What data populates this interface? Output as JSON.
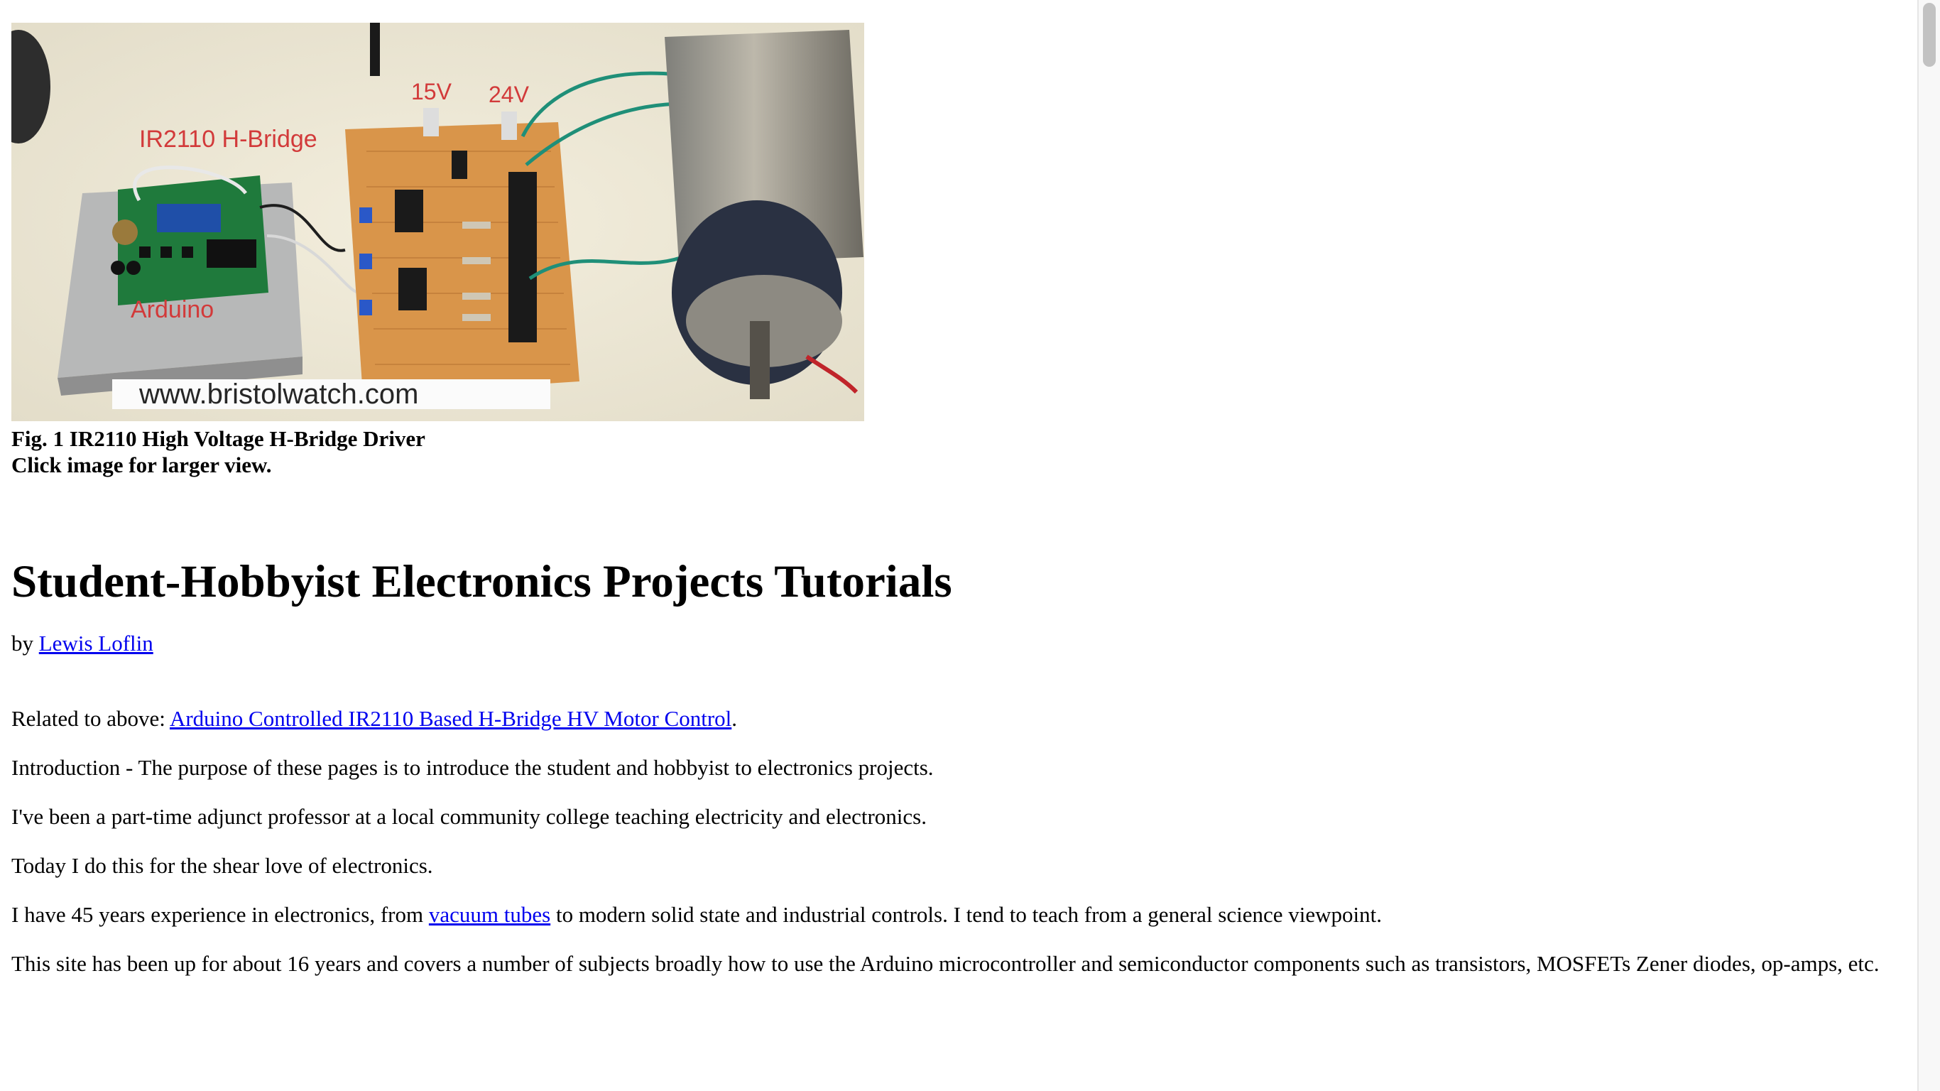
{
  "figure": {
    "labels": {
      "hbridge": "IR2110 H-Bridge",
      "arduino": "Arduino",
      "v15": "15V",
      "v24": "24V",
      "watermark": "www.bristolwatch.com"
    },
    "caption_line1": "Fig. 1 IR2110 High Voltage H-Bridge Driver",
    "caption_line2": "Click image for larger view."
  },
  "article": {
    "title": "Student-Hobbyist Electronics Projects Tutorials",
    "byline": {
      "prefix": "by ",
      "author_link": "Lewis Loflin"
    },
    "related": {
      "prefix": "Related to above: ",
      "link": "Arduino Controlled IR2110 Based H-Bridge HV Motor Control",
      "suffix": "."
    },
    "intro": "Introduction - The purpose of these pages is to introduce the student and hobbyist to electronics projects.",
    "adjunct": "I've been a part-time adjunct professor at a local community college teaching electricity and electronics.",
    "love": "Today I do this for the shear love of electronics.",
    "experience": {
      "before": "I have 45 years experience in electronics, from ",
      "link": "vacuum tubes",
      "after": " to modern solid state and industrial controls. I tend to teach from a general science viewpoint."
    },
    "site": "This site has been up for about 16 years and covers a number of subjects broadly how to use the Arduino microcontroller and semiconductor components such as transistors, MOSFETs Zener diodes, op-amps, etc."
  },
  "colors": {
    "link": "#0000ee",
    "label_red": "#d23a3a",
    "board": "#d9954a"
  }
}
